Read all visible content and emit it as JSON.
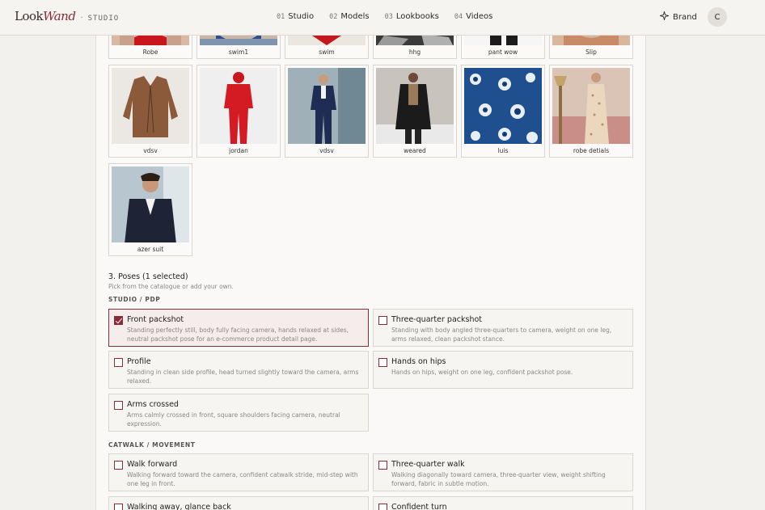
{
  "header": {
    "brand_look": "Look",
    "brand_wand": "Wand",
    "brand_sep": "·",
    "brand_studio": "STUDIO",
    "nav": [
      {
        "num": "01",
        "label": "Studio"
      },
      {
        "num": "02",
        "label": "Models"
      },
      {
        "num": "03",
        "label": "Lookbooks"
      },
      {
        "num": "04",
        "label": "Videos"
      }
    ],
    "brand_button": "Brand",
    "avatar": "C"
  },
  "garments": [
    {
      "label": "Robe"
    },
    {
      "label": "swim1"
    },
    {
      "label": "swim"
    },
    {
      "label": "hhg"
    },
    {
      "label": "pant wow"
    },
    {
      "label": "Slip"
    },
    {
      "label": "vdsv"
    },
    {
      "label": "jordan"
    },
    {
      "label": "vdsv"
    },
    {
      "label": "weared"
    },
    {
      "label": "luis"
    },
    {
      "label": "robe detials"
    },
    {
      "label": "azer suit"
    }
  ],
  "poses": {
    "title": "3. Poses (1 selected)",
    "subtitle": "Pick from the catalogue or add your own.",
    "categories": [
      {
        "name": "STUDIO / PDP",
        "items": [
          {
            "title": "Front packshot",
            "desc": "Standing perfectly still, body fully facing camera, hands relaxed at sides, neutral packshot pose for an e-commerce product detail page.",
            "selected": true
          },
          {
            "title": "Three-quarter packshot",
            "desc": "Standing with body angled three-quarters to camera, weight on one leg, arms relaxed, clean packshot stance.",
            "selected": false
          },
          {
            "title": "Profile",
            "desc": "Standing in clean side profile, head turned slightly toward the camera, arms relaxed.",
            "selected": false
          },
          {
            "title": "Hands on hips",
            "desc": "Hands on hips, weight on one leg, confident packshot pose.",
            "selected": false
          },
          {
            "title": "Arms crossed",
            "desc": "Arms calmly crossed in front, square shoulders facing camera, neutral expression.",
            "selected": false
          }
        ]
      },
      {
        "name": "CATWALK / MOVEMENT",
        "items": [
          {
            "title": "Walk forward",
            "desc": "Walking forward toward the camera, confident catwalk stride, mid-step with one leg in front.",
            "selected": false
          },
          {
            "title": "Three-quarter walk",
            "desc": "Walking diagonally toward camera, three-quarter view, weight shifting forward, fabric in subtle motion.",
            "selected": false
          },
          {
            "title": "Walking away, glance back",
            "desc": "",
            "selected": false
          },
          {
            "title": "Confident turn",
            "desc": "",
            "selected": false
          }
        ]
      }
    ]
  },
  "colors": {
    "accent": "#8a2b36",
    "panel": "#faf9f7",
    "background": "#f3f1ee"
  }
}
